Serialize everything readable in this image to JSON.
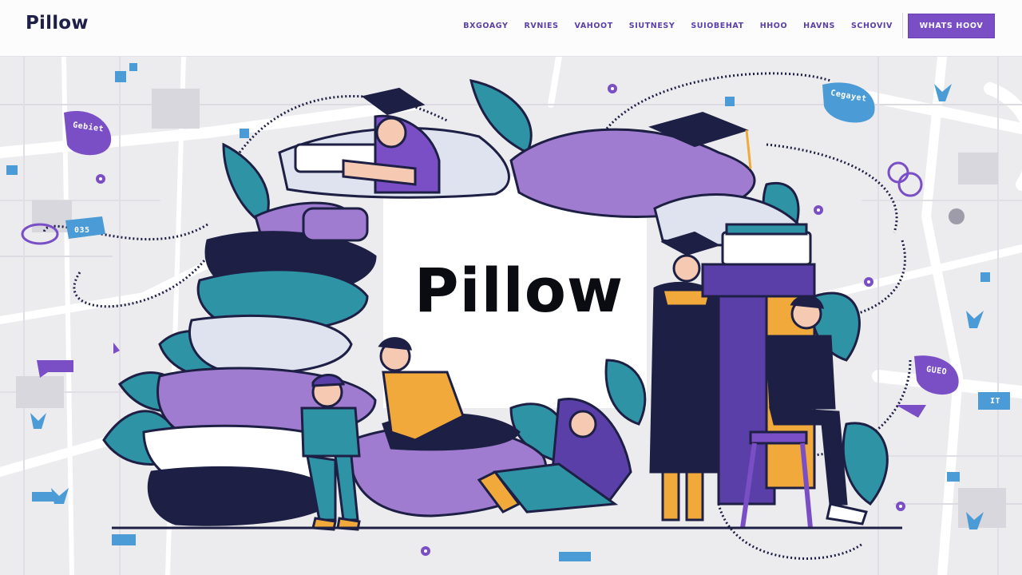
{
  "app": {
    "logo": "Pillow"
  },
  "nav": {
    "links": [
      "BXGOAGY",
      "RVNIES",
      "VAHOOT",
      "SIUTNESY",
      "SUIOBEHAT",
      "HHOO",
      "HAVNS",
      "SCHOVIV"
    ],
    "cta": "WHATS HOOV"
  },
  "hero": {
    "title": "Pillow",
    "tags": [
      "Gebiet",
      "Cegayet",
      "035",
      "GUEO",
      "IT"
    ]
  },
  "colors": {
    "accent": "#7a4fc6",
    "purple_light": "#a07cd0",
    "teal": "#2f93a6",
    "navy": "#1d1f44",
    "mustard": "#f0a93a"
  }
}
